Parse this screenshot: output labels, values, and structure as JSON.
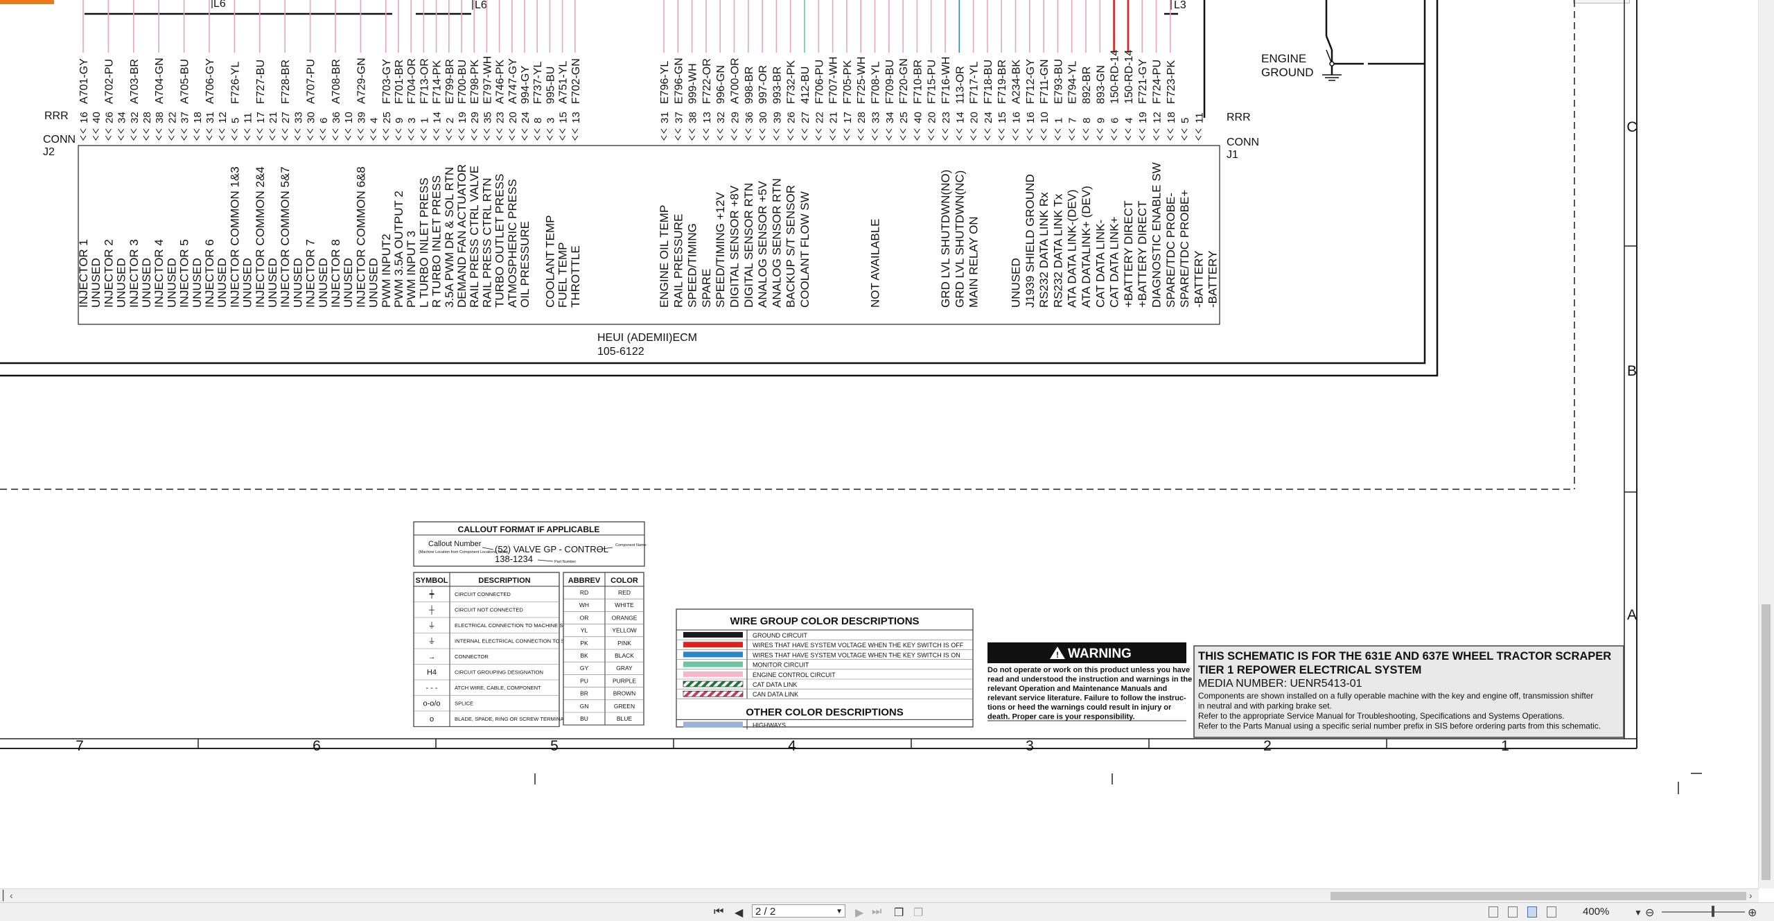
{
  "connectors": {
    "j2": {
      "rrr": "RRR",
      "conn": "CONN",
      "name": "J2"
    },
    "j1": {
      "rrr": "RRR",
      "conn": "CONN",
      "name": "J1"
    }
  },
  "top_labels": {
    "l6a": "L6",
    "l6b": "L6",
    "l3": "L3"
  },
  "engine_ground": [
    "ENGINE",
    "GROUND"
  ],
  "ecm": {
    "name": "HEUI (ADEMII)ECM",
    "part": "105-6122"
  },
  "grid_rows": [
    "C",
    "B",
    "A"
  ],
  "grid_cols": [
    "7",
    "6",
    "5",
    "4",
    "3",
    "2",
    "1"
  ],
  "pins_left": [
    {
      "wire": "A701-GY",
      "pin": "16",
      "func": "INJECTOR 1"
    },
    {
      "wire": "",
      "pin": "40",
      "func": "UNUSED"
    },
    {
      "wire": "A702-PU",
      "pin": "26",
      "func": "INJECTOR 2"
    },
    {
      "wire": "",
      "pin": "34",
      "func": "UNUSED"
    },
    {
      "wire": "A703-BR",
      "pin": "32",
      "func": "INJECTOR 3"
    },
    {
      "wire": "",
      "pin": "28",
      "func": "UNUSED"
    },
    {
      "wire": "A704-GN",
      "pin": "38",
      "func": "INJECTOR 4"
    },
    {
      "wire": "",
      "pin": "22",
      "func": "UNUSED"
    },
    {
      "wire": "A705-BU",
      "pin": "37",
      "func": "INJECTOR 5"
    },
    {
      "wire": "",
      "pin": "18",
      "func": "UNUSED"
    },
    {
      "wire": "A706-GY",
      "pin": "31",
      "func": "INJECTOR 6"
    },
    {
      "wire": "",
      "pin": "12",
      "func": "UNUSED"
    },
    {
      "wire": "F726-YL",
      "pin": "5",
      "func": "INJECTOR COMMON 1&3"
    },
    {
      "wire": "",
      "pin": "11",
      "func": "UNUSED"
    },
    {
      "wire": "F727-BU",
      "pin": "17",
      "func": "INJECTOR COMMON 2&4"
    },
    {
      "wire": "",
      "pin": "21",
      "func": "UNUSED"
    },
    {
      "wire": "F728-BR",
      "pin": "27",
      "func": "INJECTOR COMMON 5&7"
    },
    {
      "wire": "",
      "pin": "33",
      "func": "UNUSED"
    },
    {
      "wire": "A707-PU",
      "pin": "30",
      "func": "INJECTOR 7"
    },
    {
      "wire": "",
      "pin": "6",
      "func": "UNUSED"
    },
    {
      "wire": "A708-BR",
      "pin": "36",
      "func": "INJECTOR 8"
    },
    {
      "wire": "",
      "pin": "10",
      "func": "UNUSED"
    },
    {
      "wire": "A729-GN",
      "pin": "39",
      "func": "INJECTOR COMMON 6&8"
    },
    {
      "wire": "",
      "pin": "4",
      "func": "UNUSED"
    },
    {
      "wire": "F703-GY",
      "pin": "25",
      "func": "PWM INPUT2"
    },
    {
      "wire": "F701-BR",
      "pin": "9",
      "func": "PWM 3.5A OUTPUT 2"
    },
    {
      "wire": "F704-OR",
      "pin": "3",
      "func": "PWM INPUT 3"
    },
    {
      "wire": "F713-OR",
      "pin": "1",
      "func": "L TURBO INLET PRESS"
    },
    {
      "wire": "F714-PK",
      "pin": "14",
      "func": "R TURBO INLET PRESS"
    },
    {
      "wire": "E799-BR",
      "pin": "2",
      "func": "3.5A PWM DR & SOL RTN"
    },
    {
      "wire": "F700-BU",
      "pin": "19",
      "func": "DEMAND FAN ACTUATOR"
    },
    {
      "wire": "E798-PK",
      "pin": "29",
      "func": "RAIL PRESS CTRL VALVE"
    },
    {
      "wire": "E797-WH",
      "pin": "35",
      "func": "RAIL PRESS CTRL RTN"
    },
    {
      "wire": "A746-PK",
      "pin": "23",
      "func": "TURBO OUTLET PRESS"
    },
    {
      "wire": "A747-GY",
      "pin": "20",
      "func": "ATMOSPHERIC PRESS"
    },
    {
      "wire": "994-GY",
      "pin": "24",
      "func": "OIL PRESSURE"
    },
    {
      "wire": "F737-YL",
      "pin": "8",
      "func": ""
    },
    {
      "wire": "995-BU",
      "pin": "3",
      "func": "COOLANT TEMP"
    },
    {
      "wire": "A751-YL",
      "pin": "15",
      "func": "FUEL TEMP"
    },
    {
      "wire": "F702-GN",
      "pin": "13",
      "func": "THROTTLE"
    }
  ],
  "pins_right": [
    {
      "wire": "E796-YL",
      "pin": "31",
      "func": "ENGINE OIL TEMP"
    },
    {
      "wire": "E796-GN",
      "pin": "37",
      "func": "RAIL PRESSURE"
    },
    {
      "wire": "999-WH",
      "pin": "38",
      "func": "SPEED/TIMING"
    },
    {
      "wire": "F722-OR",
      "pin": "13",
      "func": "SPARE"
    },
    {
      "wire": "996-GN",
      "pin": "32",
      "func": "SPEED/TIMING +12V"
    },
    {
      "wire": "A700-OR",
      "pin": "29",
      "func": "DIGITAL SENSOR +8V"
    },
    {
      "wire": "998-BR",
      "pin": "36",
      "func": "DIGITAL SENSOR RTN"
    },
    {
      "wire": "997-OR",
      "pin": "30",
      "func": "ANALOG SENSOR +5V"
    },
    {
      "wire": "993-BR",
      "pin": "39",
      "func": "ANALOG SENSOR RTN"
    },
    {
      "wire": "F732-PK",
      "pin": "26",
      "func": "BACKUP S/T SENSOR"
    },
    {
      "wire": "412-BU",
      "pin": "27",
      "func": "COOLANT FLOW SW"
    },
    {
      "wire": "F706-PU",
      "pin": "22",
      "func": ""
    },
    {
      "wire": "F707-WH",
      "pin": "21",
      "func": ""
    },
    {
      "wire": "F705-PK",
      "pin": "17",
      "func": ""
    },
    {
      "wire": "F725-WH",
      "pin": "28",
      "func": ""
    },
    {
      "wire": "F708-YL",
      "pin": "33",
      "func": "NOT AVAILABLE"
    },
    {
      "wire": "F709-BU",
      "pin": "34",
      "func": ""
    },
    {
      "wire": "F720-GN",
      "pin": "25",
      "func": ""
    },
    {
      "wire": "F710-BR",
      "pin": "40",
      "func": ""
    },
    {
      "wire": "F715-PU",
      "pin": "20",
      "func": ""
    },
    {
      "wire": "F716-WH",
      "pin": "23",
      "func": "GRD LVL SHUTDWN(NO)"
    },
    {
      "wire": "113-OR",
      "pin": "14",
      "func": "GRD LVL SHUTDWN(NC)"
    },
    {
      "wire": "F717-YL",
      "pin": "20",
      "func": "MAIN RELAY ON"
    },
    {
      "wire": "F718-BU",
      "pin": "24",
      "func": ""
    },
    {
      "wire": "F719-BR",
      "pin": "15",
      "func": ""
    },
    {
      "wire": "A234-BK",
      "pin": "16",
      "func": "UNUSED"
    },
    {
      "wire": "F712-GY",
      "pin": "16",
      "func": "J1939 SHIELD GROUND"
    },
    {
      "wire": "F711-GN",
      "pin": "10",
      "func": "RS232 DATA LINK Rx"
    },
    {
      "wire": "E793-BU",
      "pin": "1",
      "func": "RS232 DATA LINK Tx"
    },
    {
      "wire": "E794-YL",
      "pin": "7",
      "func": "ATA DATA LINK-(DEV)"
    },
    {
      "wire": "892-BR",
      "pin": "8",
      "func": "ATA DATALINK+ (DEV)"
    },
    {
      "wire": "893-GN",
      "pin": "9",
      "func": "CAT DATA LINK-"
    },
    {
      "wire": "150-RD-14",
      "pin": "6",
      "func": "CAT DATA LINK+"
    },
    {
      "wire": "150-RD-14",
      "pin": "4",
      "func": "+BATTERY DIRECT"
    },
    {
      "wire": "F721-GY",
      "pin": "19",
      "func": "+BATTERY DIRECT"
    },
    {
      "wire": "F724-PU",
      "pin": "12",
      "func": "DIAGNOSTIC ENABLE SW"
    },
    {
      "wire": "F723-PK",
      "pin": "18",
      "func": "SPARE/TDC PROBE-"
    },
    {
      "wire": "",
      "pin": "5",
      "func": "SPARE/TDC PROBE+"
    },
    {
      "wire": "",
      "pin": "11",
      "func": "-BATTERY"
    },
    {
      "wire": "",
      "pin": "",
      "func": "-BATTERY"
    }
  ],
  "callout": {
    "title": "CALLOUT FORMAT IF APPLICABLE",
    "callout_number": "Callout Number",
    "callout_sub": "(Machine Location from Component Locations Table)",
    "example": "(52) VALVE GP - CONTROL",
    "part_example": "138-1234",
    "component_name": "Component Name",
    "part_number": "Part Number"
  },
  "symbols": {
    "headers": [
      "SYMBOL",
      "DESCRIPTION"
    ],
    "rows": [
      {
        "icon": "connected-dot-icon",
        "glyph": "┿",
        "desc": "CIRCUIT CONNECTED"
      },
      {
        "icon": "crossing-icon",
        "glyph": "┼",
        "desc": "CIRCUIT NOT CONNECTED"
      },
      {
        "icon": "machine-ground-icon",
        "glyph": "⏚",
        "desc": "ELECTRICAL CONNECTION TO MACHINE STRUCTURE"
      },
      {
        "icon": "internal-ground-icon",
        "glyph": "⏚",
        "desc": "INTERNAL ELECTRICAL CONNECTION TO SURFACE OF COMPONENT"
      },
      {
        "icon": "connector-icon",
        "glyph": "→",
        "desc": "CONNECTOR"
      },
      {
        "icon": "grouping-icon",
        "glyph": "H4",
        "desc": "CIRCUIT GROUPING DESIGNATION"
      },
      {
        "icon": "attach-wire-icon",
        "glyph": "- - -",
        "desc": "ATCH WIRE, CABLE, COMPONENT"
      },
      {
        "icon": "splice-icon",
        "glyph": "o-o/o",
        "desc": "SPLICE"
      },
      {
        "icon": "terminal-icon",
        "glyph": "o",
        "desc": "BLADE, SPADE, RING OR SCREW TERMINAL"
      }
    ]
  },
  "abbrev": {
    "headers": [
      "ABBREV",
      "COLOR"
    ],
    "rows": [
      [
        "RD",
        "RED"
      ],
      [
        "WH",
        "WHITE"
      ],
      [
        "OR",
        "ORANGE"
      ],
      [
        "YL",
        "YELLOW"
      ],
      [
        "PK",
        "PINK"
      ],
      [
        "BK",
        "BLACK"
      ],
      [
        "GY",
        "GRAY"
      ],
      [
        "PU",
        "PURPLE"
      ],
      [
        "BR",
        "BROWN"
      ],
      [
        "GN",
        "GREEN"
      ],
      [
        "BU",
        "BLUE"
      ]
    ]
  },
  "wire_groups": {
    "title": "WIRE GROUP COLOR DESCRIPTIONS",
    "rows": [
      {
        "color": "#1a1a1a",
        "style": "solid",
        "label": "GROUND CIRCUIT"
      },
      {
        "color": "#e02020",
        "style": "solid",
        "label": "WIRES THAT HAVE SYSTEM VOLTAGE WHEN THE KEY SWITCH IS OFF"
      },
      {
        "color": "#2a86c8",
        "style": "solid",
        "label": "WIRES THAT HAVE SYSTEM VOLTAGE WHEN THE KEY SWITCH IS ON"
      },
      {
        "color": "#6cc4a0",
        "style": "solid",
        "label": "MONITOR CIRCUIT"
      },
      {
        "color": "#f4b6c8",
        "style": "solid",
        "label": "ENGINE CONTROL CIRCUIT"
      },
      {
        "color": "#1f7a3a",
        "style": "hatch",
        "label": "CAT DATA LINK"
      },
      {
        "color": "#c04060",
        "style": "hatch",
        "label": "CAN DATA LINK"
      }
    ],
    "other_title": "OTHER COLOR DESCRIPTIONS",
    "other_rows": [
      {
        "color": "#9ab4d6",
        "style": "solid",
        "label": "HIGHWAYS"
      }
    ]
  },
  "warning": {
    "title": "WARNING",
    "lines": [
      "Do not operate or work on this product unless you have",
      "read and understood the instruction and warnings in the",
      "relevant Operation and Maintenance Manuals and",
      "relevant service literature. Failure to follow the instruc-",
      "tions or heed the warnings could result in injury or",
      "death. Proper care is your responsibility."
    ]
  },
  "title_block": {
    "line1": "THIS SCHEMATIC IS FOR THE 631E AND 637E WHEEL TRACTOR SCRAPER",
    "line2": "TIER 1 REPOWER ELECTRICAL SYSTEM",
    "media": "MEDIA NUMBER: UENR5413-01",
    "notes": [
      "Components are shown installed on a fully operable machine with the key and engine off, transmission shifter",
      "in neutral and with parking brake set.",
      "Refer to the appropriate Service Manual for Troubleshooting, Specifications and Systems Operations.",
      "Refer to the Parts Manual using a specific serial number prefix in SIS before ordering parts from this schematic."
    ]
  },
  "viewer": {
    "page": "2 / 2",
    "zoom": "400%"
  },
  "wire_colors": {
    "default": "#e8a6b8",
    "key_on": "#2a86c8",
    "battery": "#e02020",
    "monitor": "#6cc4a0",
    "ground": "#1a1a1a"
  }
}
